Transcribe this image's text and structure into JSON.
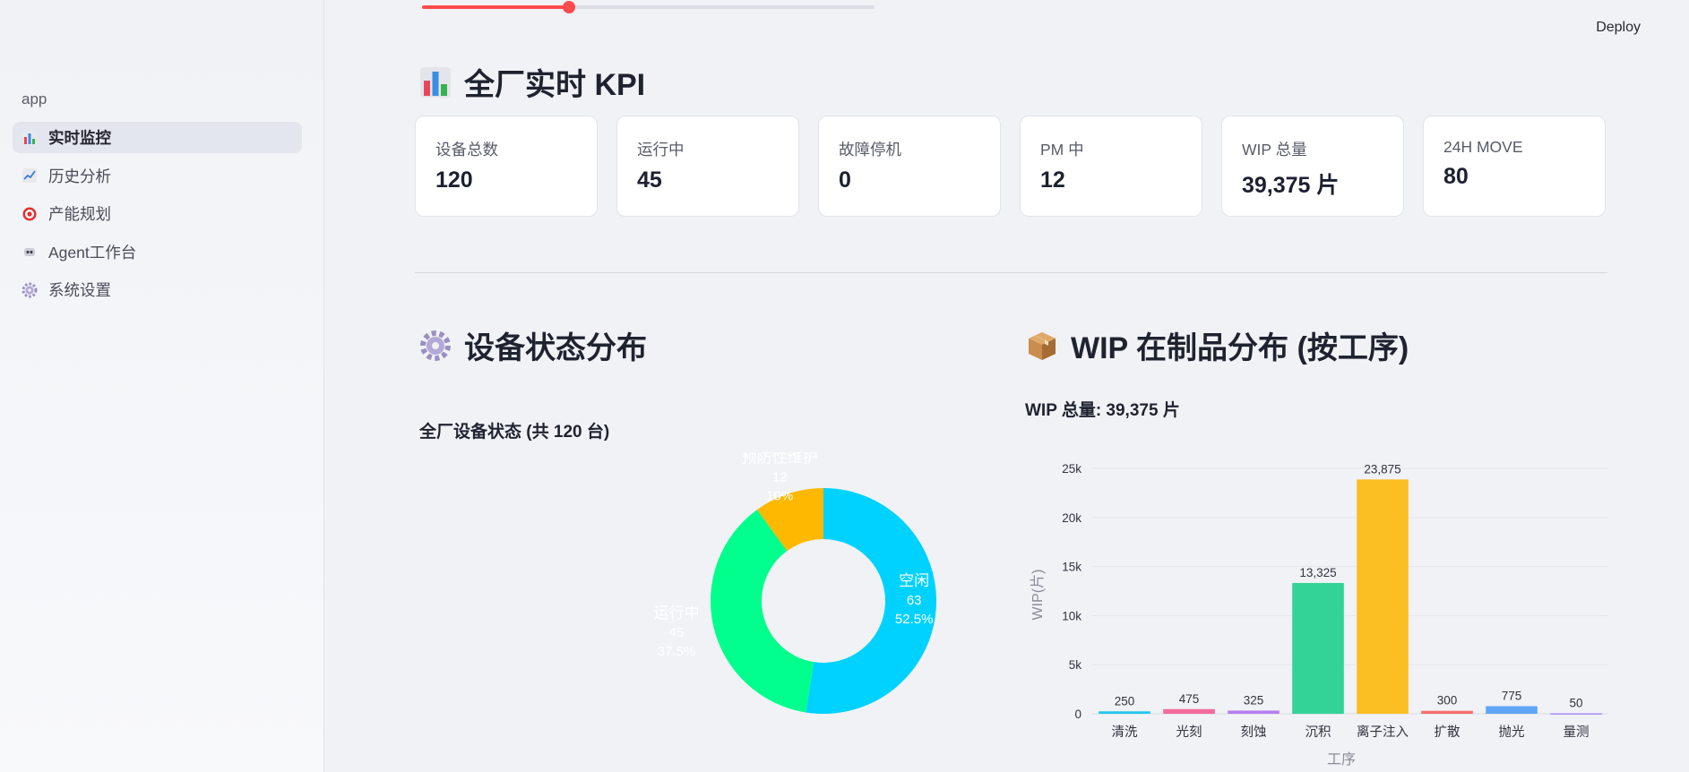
{
  "sidebar": {
    "app_label": "app",
    "items": [
      {
        "label": "实时监控",
        "icon": "bar-chart-icon",
        "active": true
      },
      {
        "label": "历史分析",
        "icon": "trend-chart-icon",
        "active": false
      },
      {
        "label": "产能规划",
        "icon": "target-icon",
        "active": false
      },
      {
        "label": "Agent工作台",
        "icon": "robot-icon",
        "active": false
      },
      {
        "label": "系统设置",
        "icon": "gear-icon",
        "active": false
      }
    ]
  },
  "header": {
    "deploy_label": "Deploy",
    "slider_progress": 0.325
  },
  "kpi_section": {
    "title": "全厂实时 KPI",
    "cards": [
      {
        "label": "设备总数",
        "value": "120"
      },
      {
        "label": "运行中",
        "value": "45"
      },
      {
        "label": "故障停机",
        "value": "0"
      },
      {
        "label": "PM 中",
        "value": "12"
      },
      {
        "label": "WIP 总量",
        "value": "39,375 片"
      },
      {
        "label": "24H MOVE",
        "value": "80"
      }
    ]
  },
  "equipment_section": {
    "title": "设备状态分布",
    "chart_title": "全厂设备状态 (共 120 台)"
  },
  "wip_section": {
    "title": "WIP 在制品分布 (按工序)",
    "chart_title": "WIP 总量: 39,375 片"
  },
  "colors": {
    "idle": "#00d2ff",
    "running": "#00ff8c",
    "pm": "#ffb800",
    "accent": "#ff4b4b"
  },
  "chart_data": [
    {
      "type": "pie",
      "donut": true,
      "labels": [
        "空闲",
        "运行中",
        "预防性维护"
      ],
      "values": [
        63,
        45,
        12
      ],
      "percents": [
        "52.5%",
        "37.5%",
        "10%"
      ],
      "colors": [
        "#00d2ff",
        "#00ff8c",
        "#ffb800"
      ],
      "legend": [
        "空闲",
        "运行中",
        "预防性维护"
      ],
      "legend_position": "right"
    },
    {
      "type": "bar",
      "categories": [
        "清洗",
        "光刻",
        "刻蚀",
        "沉积",
        "离子注入",
        "扩散",
        "抛光",
        "量测"
      ],
      "values": [
        250,
        475,
        325,
        13325,
        23875,
        300,
        775,
        50
      ],
      "value_labels": [
        "250",
        "475",
        "325",
        "13,325",
        "23,875",
        "300",
        "775",
        "50"
      ],
      "colors": [
        "#22c5ee",
        "#f46b9b",
        "#b57fef",
        "#33d397",
        "#fbbf24",
        "#f56d6d",
        "#60a5fa",
        "#a78bfa"
      ],
      "xlabel": "工序",
      "ylabel": "WIP(片)",
      "ylim": [
        0,
        25000
      ],
      "yticks": [
        0,
        5000,
        10000,
        15000,
        20000,
        25000
      ],
      "ytick_labels": [
        "0",
        "5k",
        "10k",
        "15k",
        "20k",
        "25k"
      ],
      "grid": true
    }
  ]
}
